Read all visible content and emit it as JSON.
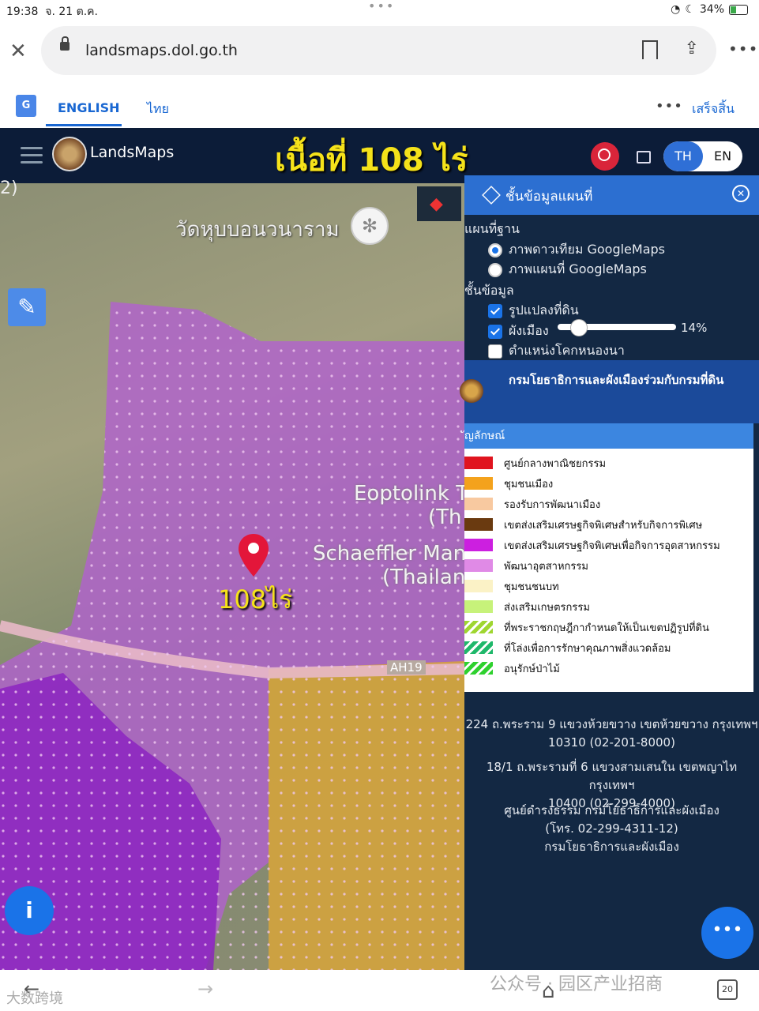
{
  "status": {
    "time": "19:38",
    "date": "จ. 21 ต.ค.",
    "battery": "34%"
  },
  "browser": {
    "url": "landsmaps.dol.go.th"
  },
  "translate": {
    "english": "ENGLISH",
    "thai": "ไทย",
    "done": "เสร็จสิ้น",
    "more": "•••"
  },
  "app": {
    "brand": "LandsMaps",
    "overlay_title": "เนื้อที่ 108 ไร่",
    "lang_th": "TH",
    "lang_en": "EN"
  },
  "map": {
    "corner_text": "2)",
    "temple": "วัดหุบบอนวนาราม",
    "place1": "Eoptolink T",
    "place1b": "(Th",
    "place2": "Schaeffler Man",
    "place2b": "(Thailan",
    "road": "AH19",
    "pin_label": "108ไร่"
  },
  "panel": {
    "title": "ชั้นข้อมูลแผนที่",
    "basemap_heading": "แผนที่ฐาน",
    "basemap_options": [
      "ภาพดาวเทียม GoogleMaps",
      "ภาพแผนที่ GoogleMaps"
    ],
    "layers_heading": "ชั้นข้อมูล",
    "layers": [
      "รูปแปลงที่ดิน",
      "ผังเมือง",
      "ตำแหน่งโคกหนองนา"
    ],
    "opacity": "14%",
    "department": "กรมโยธาธิการและผังเมืองร่วมกับกรมที่ดิน",
    "legend_heading": "ัญลักษณ์",
    "legend": [
      {
        "label": "ศูนย์กลางพาณิชยกรรม",
        "color": "#e0141e"
      },
      {
        "label": "ชุมชนเมือง",
        "color": "#f4a21c"
      },
      {
        "label": "รองรับการพัฒนาเมือง",
        "color": "#f8c9a0"
      },
      {
        "label": "เขตส่งเสริมเศรษฐกิจพิเศษสำหรับกิจการพิเศษ",
        "color": "#6a3a10"
      },
      {
        "label": "เขตส่งเสริมเศรษฐกิจพิเศษเพื่อกิจการอุตสาหกรรม",
        "color": "#cc1fe0"
      },
      {
        "label": "พัฒนาอุตสาหกรรม",
        "color": "#e08ae6"
      },
      {
        "label": "ชุมชนชนบท",
        "color": "#fbf2c6"
      },
      {
        "label": "ส่งเสริมเกษตรกรรม",
        "color": "#c7f27a"
      },
      {
        "label": "ที่พระราชกฤษฎีกากำหนดให้เป็นเขตปฏิรูปที่ดิน",
        "color": "#9fd630"
      },
      {
        "label": "ที่โล่งเพื่อการรักษาคุณภาพสิ่งแวดล้อม",
        "color": "#1fb86a"
      },
      {
        "label": "อนุรักษ์ป่าไม้",
        "color": "#2ed12e"
      }
    ],
    "addresses": [
      [
        "224 ถ.พระราม 9 แขวงห้วยขวาง เขตห้วยขวาง กรุงเทพฯ",
        "10310 (02-201-8000)"
      ],
      [
        "18/1 ถ.พระรามที่ 6 แขวงสามเสนใน เขตพญาไท กรุงเทพฯ",
        "10400 (02-299-4000)"
      ],
      [
        "ศูนย์ดำรงธรรม กรมโยธาธิการและผังเมือง",
        "(โทร. 02-299-4311-12)",
        "กรมโยธาธิการและผังเมือง"
      ]
    ]
  },
  "bottom": {
    "tabs_count": "20",
    "watermark": "公众号 · 园区产业招商",
    "watermark2": "大数跨境"
  }
}
